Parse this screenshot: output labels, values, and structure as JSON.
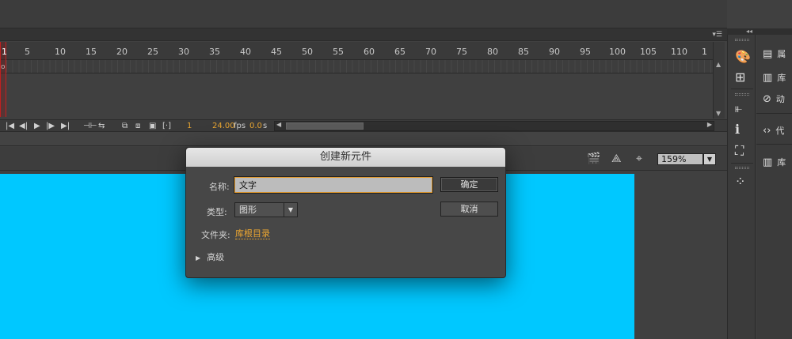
{
  "timeline": {
    "ruler_ticks": [
      "5",
      "10",
      "15",
      "20",
      "25",
      "30",
      "35",
      "40",
      "45",
      "50",
      "55",
      "60",
      "65",
      "70",
      "75",
      "80",
      "85",
      "90",
      "95",
      "100",
      "105",
      "110",
      "1"
    ],
    "current_frame_label": "1",
    "keyframe_marker": "o",
    "controls": {
      "frame": "1",
      "fps_value": "24.00",
      "fps_unit": "fps",
      "time_value": "0.0",
      "time_unit": "s"
    }
  },
  "stage": {
    "zoom": "159%",
    "canvas_color": "#00c8ff"
  },
  "dialog": {
    "title": "创建新元件",
    "name_label": "名称:",
    "name_value": "文字",
    "type_label": "类型:",
    "type_value": "图形",
    "folder_label": "文件夹:",
    "folder_value": "库根目录",
    "advanced_label": "高级",
    "ok_label": "确定",
    "cancel_label": "取消"
  },
  "right_panels": {
    "items": [
      {
        "label": "属"
      },
      {
        "label": "库"
      },
      {
        "label": "动"
      },
      {
        "label": "代"
      },
      {
        "label": "库"
      }
    ]
  },
  "colors": {
    "accent_orange": "#e8a531",
    "playhead_red": "#c02020"
  }
}
